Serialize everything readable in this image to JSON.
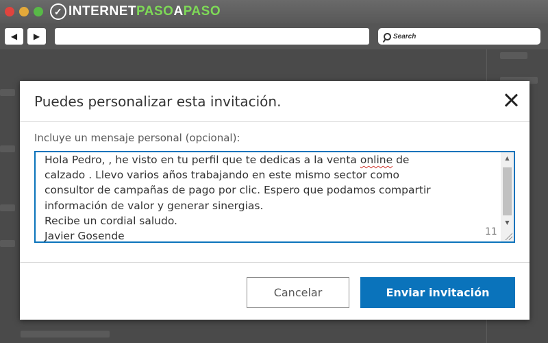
{
  "browser": {
    "brand": {
      "part1": "INTERNET",
      "part2": "PASO",
      "part3": "A",
      "part4": "PASO"
    },
    "nav": {
      "back_glyph": "◀",
      "forward_glyph": "▶"
    },
    "search": {
      "label": "Search",
      "icon": "search-icon"
    }
  },
  "modal": {
    "title": "Puedes personalizar esta invitación.",
    "field_label": "Incluye un mensaje personal (opcional):",
    "message": {
      "line1_a": "Hola Pedro, , he visto en tu perfil que te dedicas a la venta ",
      "line1_b": "online",
      "line1_c": " de",
      "line2": "calzado . Llevo varios años trabajando en este mismo sector como",
      "line3": "consultor de campañas de pago por clic. Espero que podamos compartir",
      "line4": "información de valor y generar sinergias.",
      "line5": "Recibe un cordial saludo.",
      "line6_a": "Javier ",
      "line6_b": "Gosende"
    },
    "char_count": "11",
    "cancel_label": "Cancelar",
    "send_label": "Enviar invitación"
  },
  "colors": {
    "primary": "#0a73bb",
    "title_text": "#333333",
    "label_text": "#595959"
  }
}
